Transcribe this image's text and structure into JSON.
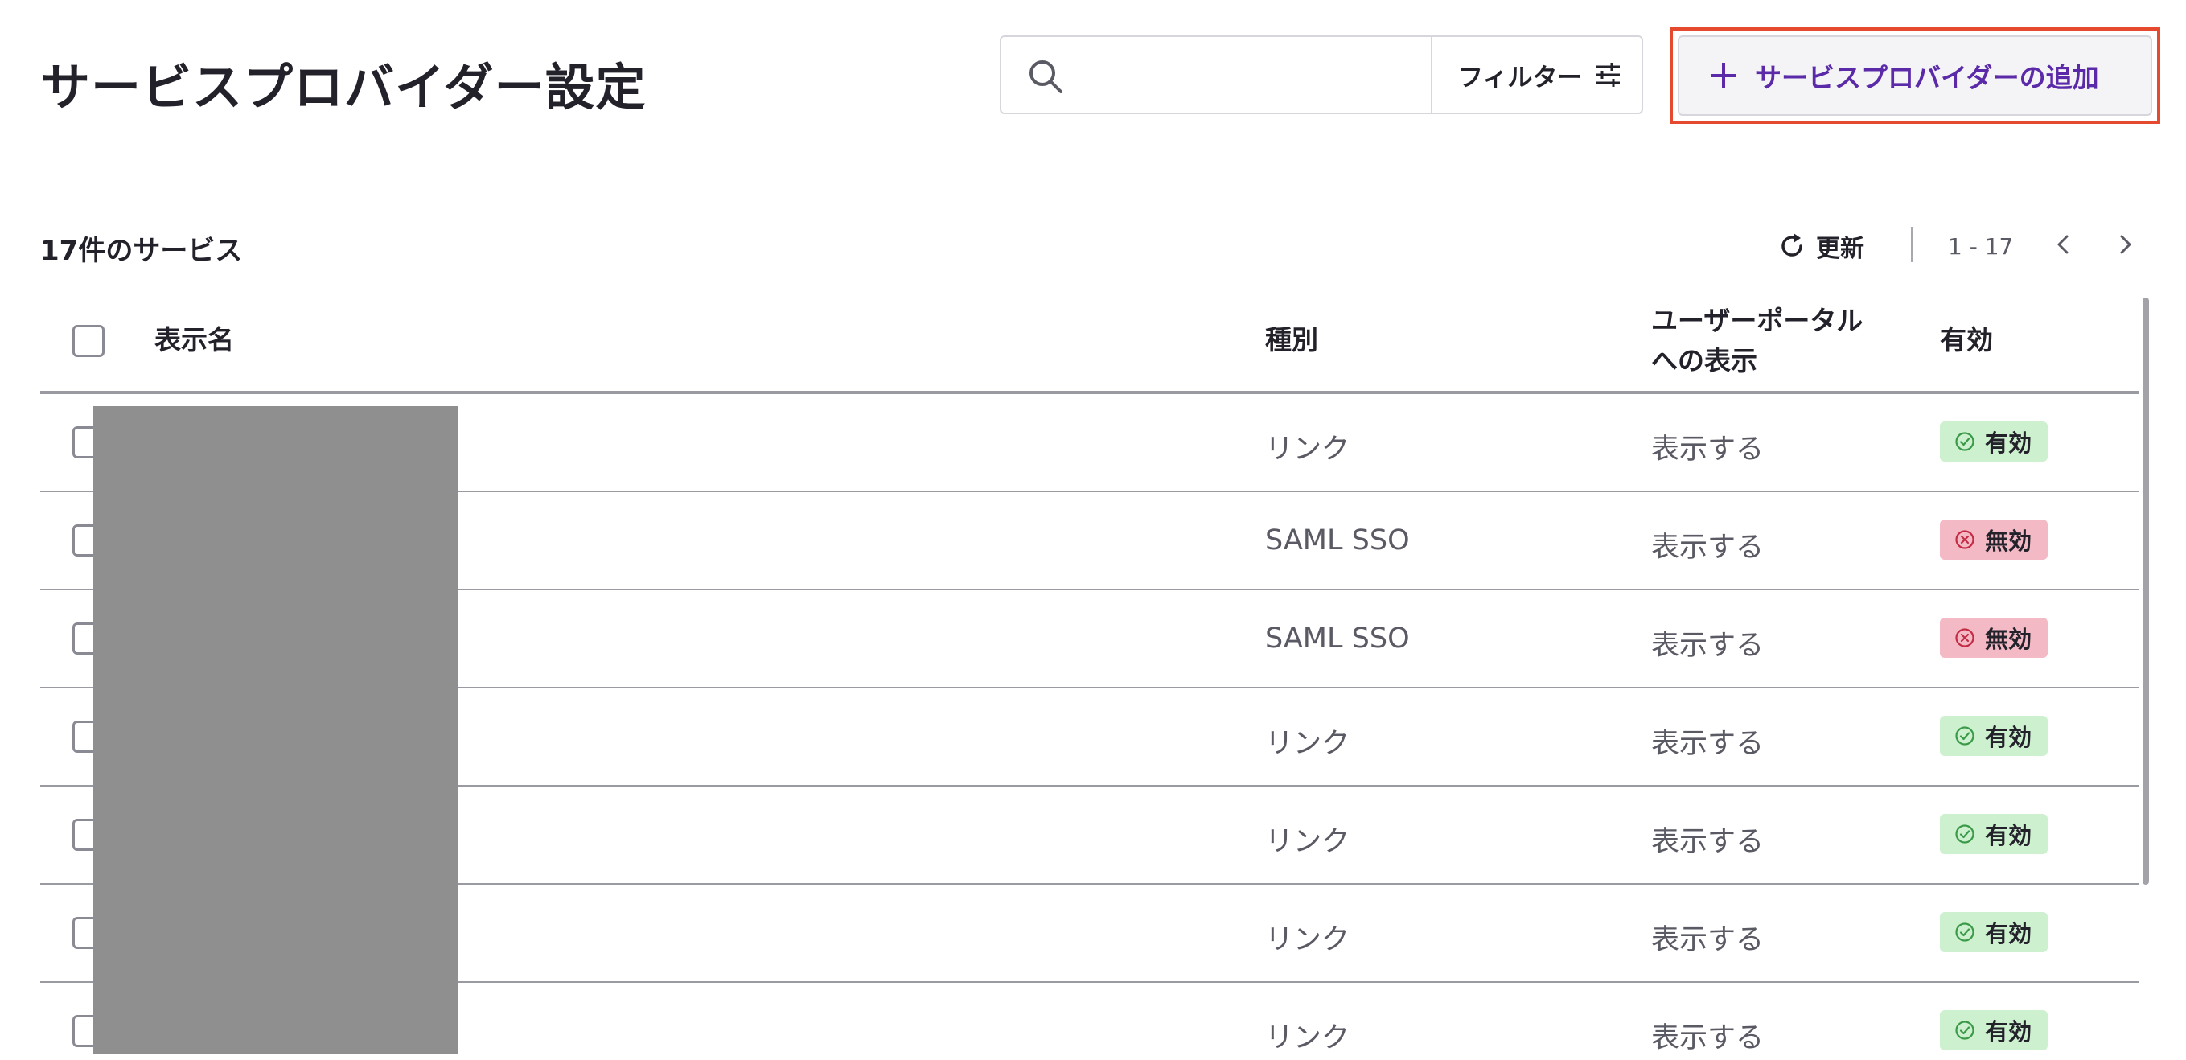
{
  "header": {
    "title": "サービスプロバイダー設定",
    "search_placeholder": "",
    "filter_label": "フィルター",
    "add_button_label": "サービスプロバイダーの追加"
  },
  "toolbar": {
    "count_text": "17件のサービス",
    "refresh_label": "更新",
    "page_range": "1 - 17"
  },
  "table": {
    "headers": {
      "display_name": "表示名",
      "type": "種別",
      "portal_line1": "ユーザーポータル",
      "portal_line2": "への表示",
      "enabled": "有効"
    },
    "rows": [
      {
        "type": "リンク",
        "portal": "表示する",
        "status": "有効",
        "status_kind": "enabled"
      },
      {
        "type": "SAML SSO",
        "portal": "表示する",
        "status": "無効",
        "status_kind": "disabled"
      },
      {
        "type": "SAML SSO",
        "portal": "表示する",
        "status": "無効",
        "status_kind": "disabled"
      },
      {
        "type": "リンク",
        "portal": "表示する",
        "status": "有効",
        "status_kind": "enabled"
      },
      {
        "type": "リンク",
        "portal": "表示する",
        "status": "有効",
        "status_kind": "enabled"
      },
      {
        "type": "リンク",
        "portal": "表示する",
        "status": "有効",
        "status_kind": "enabled"
      },
      {
        "type": "リンク",
        "portal": "表示する",
        "status": "有効",
        "status_kind": "enabled"
      }
    ]
  },
  "colors": {
    "accent": "#5b2aa8",
    "highlight_border": "#e64a2e",
    "enabled_badge": "#cdf0cf",
    "disabled_badge": "#f3b9c4",
    "redaction": "#8f8f8f"
  },
  "icons": {
    "search": "search-icon",
    "filter": "sliders-icon",
    "add": "plus-icon",
    "refresh": "refresh-icon",
    "prev": "chevron-left-icon",
    "next": "chevron-right-icon",
    "enabled": "check-circle-icon",
    "disabled": "x-circle-icon"
  }
}
